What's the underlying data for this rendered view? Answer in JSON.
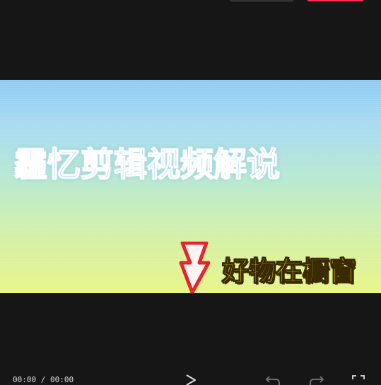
{
  "toolbar": {
    "secondary_button_label": "",
    "primary_button_label": ""
  },
  "preview": {
    "title_overlay": "霾忆剪辑视频解说",
    "shop_overlay": "好物在橱窗",
    "arrow_icon": "down-arrow-icon"
  },
  "playback": {
    "current_time": "00:00",
    "total_time": "00:00",
    "time_separator": " / ",
    "play_icon": "play-icon",
    "undo_icon": "undo-icon",
    "redo_icon": "redo-icon",
    "fullscreen_icon": "fullscreen-icon"
  },
  "colors": {
    "background": "#161616",
    "primary_accent": "#ff2f54",
    "title_blue": "#6fc0ff",
    "shop_yellow": "#ffe900",
    "arrow_red": "#e8242b"
  }
}
